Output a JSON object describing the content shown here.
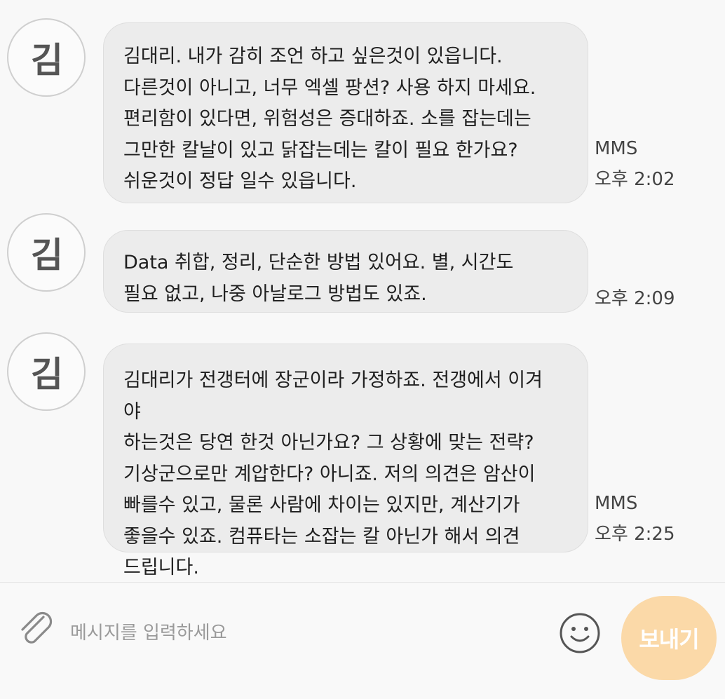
{
  "messages": [
    {
      "avatar": "김",
      "text": "김대리. 내가 감히 조언 하고 싶은것이 있읍니다.\n다른것이 아니고, 너무 엑셀 팡션? 사용 하지 마세요.\n편리함이 있다면, 위험성은 증대하죠. 소를 잡는데는\n그만한 칼날이 있고 닭잡는데는 칼이 필요 한가요?\n쉬운것이  정답 일수 있읍니다.",
      "type": "MMS",
      "time": "오후 2:02"
    },
    {
      "avatar": "김",
      "text": "Data  취합, 정리, 단순한 방법 있어요.  별, 시간도\n필요 없고, 나중 아날로그 방법도 있죠.",
      "type": "",
      "time": "오후 2:09"
    },
    {
      "avatar": "김",
      "text": "김대리가 전갱터에 장군이라 가정하죠. 전갱에서 이겨야\n하는것은 당연 한것 아닌가요? 그 상황에 맞는 전략?\n기상군으로만 계압한다? 아니죠. 저의 의견은 암산이\n빠를수 있고, 물론 사람에 차이는 있지만, 계산기가\n좋을수 있죠. 컴퓨타는 소잡는 칼 아닌가 해서 의견\n드립니다.",
      "type": "MMS",
      "time": "오후 2:25"
    }
  ],
  "composer": {
    "placeholder": "메시지를 입력하세요",
    "send_label": "보내기",
    "attach_icon": "paperclip-icon",
    "emoji_icon": "smiley-icon"
  },
  "colors": {
    "bubble": "#ececec",
    "send_button": "#fbd9a8",
    "background": "#f8f8f8"
  }
}
